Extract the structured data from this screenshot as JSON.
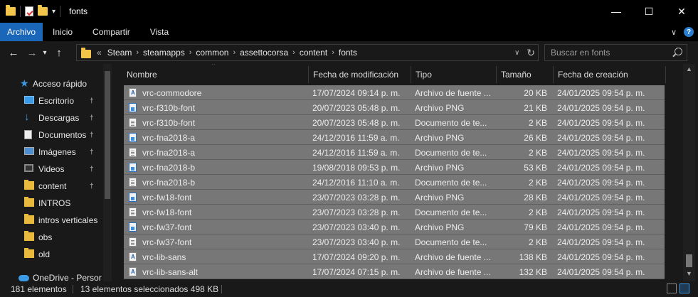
{
  "window": {
    "title": "fonts"
  },
  "ribbon": {
    "tabs": [
      "Archivo",
      "Inicio",
      "Compartir",
      "Vista"
    ]
  },
  "address": {
    "prefix": "«",
    "crumbs": [
      "Steam",
      "steamapps",
      "common",
      "assettocorsa",
      "content",
      "fonts"
    ],
    "separator": "›"
  },
  "search": {
    "placeholder": "Buscar en fonts"
  },
  "nav": {
    "items": [
      {
        "label": "Acceso rápido",
        "icon": "star-icon",
        "pinned": false
      },
      {
        "label": "Escritorio",
        "icon": "desktop-icon",
        "pinned": true
      },
      {
        "label": "Descargas",
        "icon": "downloads-icon",
        "pinned": true
      },
      {
        "label": "Documentos",
        "icon": "documents-icon",
        "pinned": true
      },
      {
        "label": "Imágenes",
        "icon": "pictures-icon",
        "pinned": true
      },
      {
        "label": "Videos",
        "icon": "videos-icon",
        "pinned": true
      },
      {
        "label": "content",
        "icon": "folder-icon",
        "pinned": true
      },
      {
        "label": "INTROS",
        "icon": "folder-icon",
        "pinned": false
      },
      {
        "label": "intros verticales",
        "icon": "folder-icon",
        "pinned": false
      },
      {
        "label": "obs",
        "icon": "folder-icon",
        "pinned": false
      },
      {
        "label": "old",
        "icon": "folder-icon",
        "pinned": false
      },
      {
        "label": "OneDrive - Persor",
        "icon": "onedrive-icon",
        "pinned": false
      }
    ],
    "pin_glyph": "📌"
  },
  "columns": {
    "name": "Nombre",
    "modified": "Fecha de modificación",
    "type": "Tipo",
    "size": "Tamaño",
    "created": "Fecha de creación"
  },
  "files": [
    {
      "name": "vrc-commodore",
      "modified": "17/07/2024 09:14 p. m.",
      "type": "Archivo de fuente ...",
      "size": "20 KB",
      "created": "24/01/2025 09:54 p. m.",
      "icon": "font-file-icon"
    },
    {
      "name": "vrc-f310b-font",
      "modified": "20/07/2023 05:48 p. m.",
      "type": "Archivo PNG",
      "size": "21 KB",
      "created": "24/01/2025 09:54 p. m.",
      "icon": "png-file-icon"
    },
    {
      "name": "vrc-f310b-font",
      "modified": "20/07/2023 05:48 p. m.",
      "type": "Documento de te...",
      "size": "2 KB",
      "created": "24/01/2025 09:54 p. m.",
      "icon": "text-file-icon"
    },
    {
      "name": "vrc-fna2018-a",
      "modified": "24/12/2016 11:59 a. m.",
      "type": "Archivo PNG",
      "size": "26 KB",
      "created": "24/01/2025 09:54 p. m.",
      "icon": "png-file-icon"
    },
    {
      "name": "vrc-fna2018-a",
      "modified": "24/12/2016 11:59 a. m.",
      "type": "Documento de te...",
      "size": "2 KB",
      "created": "24/01/2025 09:54 p. m.",
      "icon": "text-file-icon"
    },
    {
      "name": "vrc-fna2018-b",
      "modified": "19/08/2018 09:53 p. m.",
      "type": "Archivo PNG",
      "size": "53 KB",
      "created": "24/01/2025 09:54 p. m.",
      "icon": "png-file-icon"
    },
    {
      "name": "vrc-fna2018-b",
      "modified": "24/12/2016 11:10 a. m.",
      "type": "Documento de te...",
      "size": "2 KB",
      "created": "24/01/2025 09:54 p. m.",
      "icon": "text-file-icon"
    },
    {
      "name": "vrc-fw18-font",
      "modified": "23/07/2023 03:28 p. m.",
      "type": "Archivo PNG",
      "size": "28 KB",
      "created": "24/01/2025 09:54 p. m.",
      "icon": "png-file-icon"
    },
    {
      "name": "vrc-fw18-font",
      "modified": "23/07/2023 03:28 p. m.",
      "type": "Documento de te...",
      "size": "2 KB",
      "created": "24/01/2025 09:54 p. m.",
      "icon": "text-file-icon"
    },
    {
      "name": "vrc-fw37-font",
      "modified": "23/07/2023 03:40 p. m.",
      "type": "Archivo PNG",
      "size": "79 KB",
      "created": "24/01/2025 09:54 p. m.",
      "icon": "png-file-icon"
    },
    {
      "name": "vrc-fw37-font",
      "modified": "23/07/2023 03:40 p. m.",
      "type": "Documento de te...",
      "size": "2 KB",
      "created": "24/01/2025 09:54 p. m.",
      "icon": "text-file-icon"
    },
    {
      "name": "vrc-lib-sans",
      "modified": "17/07/2024 09:20 p. m.",
      "type": "Archivo de fuente ...",
      "size": "138 KB",
      "created": "24/01/2025 09:54 p. m.",
      "icon": "font-file-icon"
    },
    {
      "name": "vrc-lib-sans-alt",
      "modified": "17/07/2024 07:15 p. m.",
      "type": "Archivo de fuente ...",
      "size": "132 KB",
      "created": "24/01/2025 09:54 p. m.",
      "icon": "font-file-icon"
    }
  ],
  "status": {
    "count": "181 elementos",
    "selected": "13 elementos seleccionados  498 KB"
  }
}
